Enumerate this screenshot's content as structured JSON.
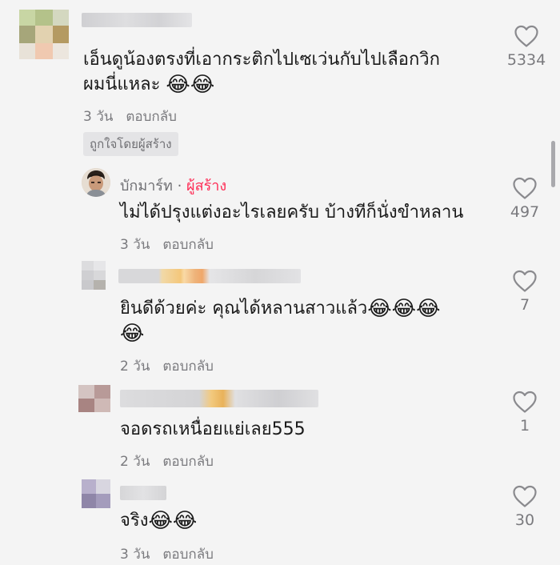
{
  "comments": [
    {
      "text_line1": "เอ็นดูน้องตรงที่เอากระติกไปเซเว่นกับไปเลือกวิก",
      "text_line2": "ผมนี่แหละ",
      "emoji": "😂",
      "time": "3 วัน",
      "reply": "ตอบกลับ",
      "badge": "ถูกใจโดยผู้สร้าง",
      "likes": "5334",
      "heart_icon": "heart-icon"
    },
    {
      "author": "บักมาร์ท",
      "separator": "·",
      "creator_label": "ผู้สร้าง",
      "text_line1": "ไม่ได้ปรุงแต่งอะไรเลยครับ บ้างทีก็นั่งขำหลาน",
      "time": "3 วัน",
      "reply": "ตอบกลับ",
      "likes": "497"
    },
    {
      "text_line1": "ยินดีด้วยค่ะ คุณได้หลานสาวแล้ว",
      "emoji": "😂",
      "time": "2 วัน",
      "reply": "ตอบกลับ",
      "likes": "7"
    },
    {
      "text_line1": "จอดรถเหนื่อยแย่เลย555",
      "time": "2 วัน",
      "reply": "ตอบกลับ",
      "likes": "1"
    },
    {
      "text_line1": "จริง",
      "emoji": "😂",
      "time": "3 วัน",
      "reply": "ตอบกลับ",
      "likes": "30"
    }
  ],
  "colors": {
    "creator_accent": "#fe2c55",
    "meta_gray": "#7a7a7e",
    "background": "#f4f4f4"
  }
}
